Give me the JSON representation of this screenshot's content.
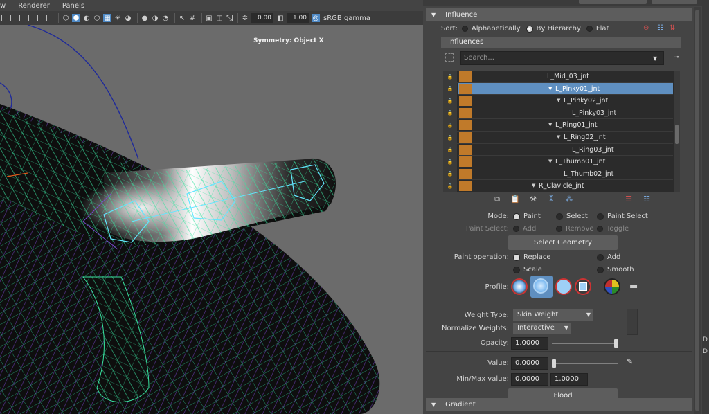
{
  "viewport": {
    "menu": [
      "w",
      "Renderer",
      "Panels"
    ],
    "toolbar": {
      "field_a": "0.00",
      "field_b": "1.00",
      "color_space": "sRGB gamma"
    },
    "symmetry_label": "Symmetry: Object X"
  },
  "influence_panel": {
    "section_title": "Influence",
    "sort": {
      "label": "Sort:",
      "options": [
        "Alphabetically",
        "By Hierarchy",
        "Flat"
      ],
      "selected": "By Hierarchy"
    },
    "influences_title": "Influences",
    "search_placeholder": "Search...",
    "joints": [
      {
        "name": "L_Mid_03_jnt",
        "expanded": false,
        "selected": false
      },
      {
        "name": "L_Pinky01_jnt",
        "expanded": true,
        "selected": true
      },
      {
        "name": "L_Pinky02_jnt",
        "expanded": true,
        "selected": false
      },
      {
        "name": "L_Pinky03_jnt",
        "expanded": false,
        "selected": false
      },
      {
        "name": "L_Ring01_jnt",
        "expanded": true,
        "selected": false
      },
      {
        "name": "L_Ring02_jnt",
        "expanded": true,
        "selected": false
      },
      {
        "name": "L_Ring03_jnt",
        "expanded": false,
        "selected": false
      },
      {
        "name": "L_Thumb01_jnt",
        "expanded": true,
        "selected": false
      },
      {
        "name": "L_Thumb02_jnt",
        "expanded": false,
        "selected": false
      },
      {
        "name": "R_Clavicle_jnt",
        "expanded": true,
        "selected": false
      }
    ],
    "joint_color": "#c07a2a",
    "selection_color": "#5f8fc0"
  },
  "paint": {
    "mode": {
      "label": "Mode:",
      "options": [
        "Paint",
        "Select",
        "Paint Select"
      ],
      "selected": "Paint"
    },
    "paint_select": {
      "label": "Paint Select:",
      "options": [
        "Add",
        "Remove",
        "Toggle"
      ]
    },
    "select_geometry": "Select Geometry",
    "operation": {
      "label": "Paint operation:",
      "options": [
        "Replace",
        "Add",
        "Scale",
        "Smooth"
      ],
      "selected": "Replace"
    },
    "profile_label": "Profile:",
    "weight_type": {
      "label": "Weight Type:",
      "value": "Skin Weight"
    },
    "normalize": {
      "label": "Normalize Weights:",
      "value": "Interactive"
    },
    "opacity": {
      "label": "Opacity:",
      "value": "1.0000",
      "level": 1.0
    },
    "value": {
      "label": "Value:",
      "value": "0.0000",
      "level": 0.0
    },
    "minmax": {
      "label": "Min/Max value:",
      "min": "0.0000",
      "max": "1.0000"
    },
    "flood": "Flood"
  },
  "gradient_title": "Gradient",
  "edge_chars": [
    "D",
    "D"
  ]
}
